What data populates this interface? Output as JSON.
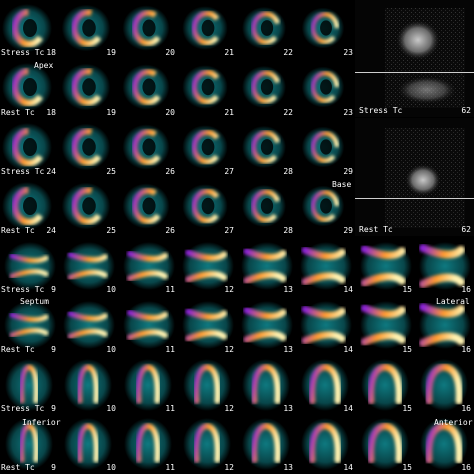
{
  "row_labels": {
    "stress": "Stress Tc",
    "rest": "Rest Tc"
  },
  "annotations": {
    "apex": "Apex",
    "base": "Base",
    "septum": "Septum",
    "lateral": "Lateral",
    "inferior": "Inferior",
    "anterior": "Anterior"
  },
  "raw_panels": [
    {
      "label": "Stress Tc",
      "number": "62"
    },
    {
      "label": "Rest Tc",
      "number": "62"
    }
  ],
  "rows": [
    {
      "type": "stress",
      "shape": "short",
      "numbers": [
        "18",
        "19",
        "20",
        "21",
        "22",
        "23"
      ]
    },
    {
      "type": "rest",
      "shape": "short",
      "numbers": [
        "18",
        "19",
        "20",
        "21",
        "22",
        "23"
      ]
    },
    {
      "type": "stress",
      "shape": "short",
      "numbers": [
        "24",
        "25",
        "26",
        "27",
        "28",
        "29"
      ]
    },
    {
      "type": "rest",
      "shape": "short",
      "numbers": [
        "24",
        "25",
        "26",
        "27",
        "28",
        "29"
      ]
    },
    {
      "type": "stress",
      "shape": "vla",
      "numbers": [
        "9",
        "10",
        "11",
        "12",
        "13",
        "14",
        "15",
        "16"
      ]
    },
    {
      "type": "rest",
      "shape": "vla",
      "numbers": [
        "9",
        "10",
        "11",
        "12",
        "13",
        "14",
        "15",
        "16"
      ]
    },
    {
      "type": "stress",
      "shape": "hla",
      "numbers": [
        "9",
        "10",
        "11",
        "12",
        "13",
        "14",
        "15",
        "16"
      ]
    },
    {
      "type": "rest",
      "shape": "hla",
      "numbers": [
        "9",
        "10",
        "11",
        "12",
        "13",
        "14",
        "15",
        "16"
      ]
    }
  ],
  "colors": {
    "background": "#000000",
    "halo": "#0f7f86",
    "wall": "#8a22d8",
    "hot": "#ff9a2e",
    "peak": "#fff2b0"
  }
}
